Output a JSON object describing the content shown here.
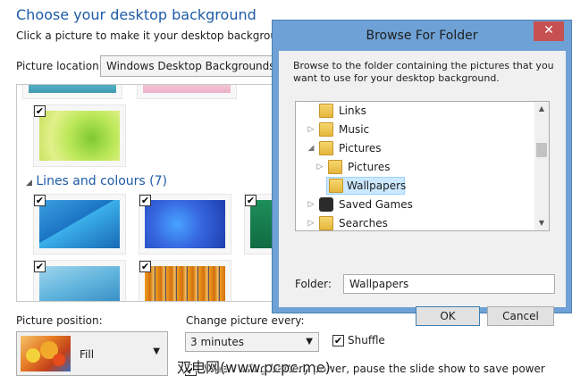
{
  "main": {
    "title": "Choose your desktop background",
    "description": "Click a picture to make it your desktop background, or",
    "picture_location": {
      "label": "Picture location:",
      "value": "Windows Desktop Backgrounds"
    },
    "group": {
      "name": "Lines and colours (7)"
    },
    "picture_position": {
      "label": "Picture position:",
      "value": "Fill"
    },
    "change_picture": {
      "label": "Change picture every:",
      "value": "3 minutes"
    },
    "shuffle": {
      "label": "Shuffle",
      "checked": true
    },
    "battery": {
      "label": "When using battery power, pause the slide show to save power",
      "checked": true
    }
  },
  "dialog": {
    "title": "Browse For Folder",
    "description": "Browse to the folder containing the pictures that you want to use for your desktop background.",
    "tree": [
      {
        "label": "Links",
        "icon": "links-folder-icon"
      },
      {
        "label": "Music",
        "icon": "music-folder-icon"
      },
      {
        "label": "Pictures",
        "icon": "pictures-folder-icon"
      },
      {
        "label": "Pictures",
        "icon": "folder-icon"
      },
      {
        "label": "Wallpapers",
        "icon": "folder-icon",
        "selected": true
      },
      {
        "label": "Saved Games",
        "icon": "saved-games-icon"
      },
      {
        "label": "Searches",
        "icon": "searches-icon"
      }
    ],
    "folder": {
      "label": "Folder:",
      "value": "Wallpapers"
    },
    "ok_label": "OK",
    "cancel_label": "Cancel"
  },
  "watermark": {
    "text": "双电网(www.pcpc.me)"
  },
  "colors": {
    "accent": "#1e5aa6",
    "dialog_frame": "#6ea2d6",
    "close": "#c75050",
    "selection": "#cce8ff"
  }
}
